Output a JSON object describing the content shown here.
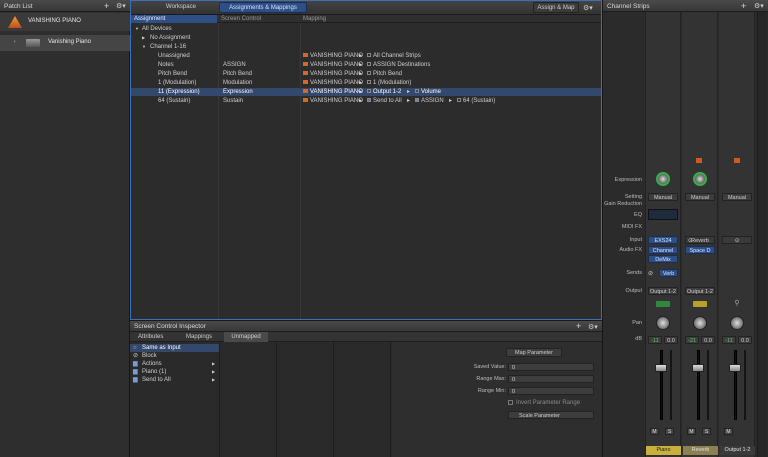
{
  "patch_list": {
    "title": "Patch List",
    "items": [
      {
        "name": "VANISHING PIANO",
        "selected": true
      },
      {
        "name": "Vanishing Piano",
        "selected": false
      }
    ]
  },
  "mapping_window": {
    "tabs": [
      {
        "label": "Workspace",
        "active": false
      },
      {
        "label": "Assignments & Mappings",
        "active": true
      }
    ],
    "assign_map_label": "Assign & Map",
    "columns": {
      "assignment": "Assignment",
      "screen_control": "Screen Control",
      "mapping": "Mapping"
    },
    "tree": [
      {
        "label": "All Devices",
        "indent": 0,
        "arrow": "▼"
      },
      {
        "label": "No Assignment",
        "indent": 1,
        "arrow": "▶"
      },
      {
        "label": "Channel 1-16",
        "indent": 1,
        "arrow": "▼"
      }
    ],
    "rows": [
      {
        "assignment": "Unassigned",
        "control": "",
        "patch": "VANISHING PIANO",
        "target": "All Channel Strips",
        "target2": "",
        "target3": "",
        "selected": false
      },
      {
        "assignment": "Notes",
        "control": "ASSIGN",
        "patch": "VANISHING PIANO",
        "target": "ASSIGN Destinations",
        "target2": "",
        "target3": "",
        "selected": false
      },
      {
        "assignment": "Pitch Bend",
        "control": "Pitch Bend",
        "patch": "VANISHING PIANO",
        "target": "Pitch Bend",
        "target2": "",
        "target3": "",
        "selected": false
      },
      {
        "assignment": "1 (Modulation)",
        "control": "Modulation",
        "patch": "VANISHING PIANO",
        "target": "1 (Modulation)",
        "target2": "",
        "target3": "",
        "selected": false
      },
      {
        "assignment": "11 (Expression)",
        "control": "Expression",
        "patch": "VANISHING PIANO",
        "target": "Output 1-2",
        "target2": "Volume",
        "target3": "",
        "selected": true
      },
      {
        "assignment": "64 (Sustain)",
        "control": "Sustain",
        "patch": "VANISHING PIANO",
        "target": "Send to All",
        "target2": "ASSIGN",
        "target3": "64 (Sustain)",
        "selected": false
      }
    ]
  },
  "inspector": {
    "title": "Screen Control Inspector",
    "tabs": [
      {
        "label": "Attributes",
        "active": false
      },
      {
        "label": "Mappings",
        "active": false
      },
      {
        "label": "Unmapped",
        "active": true
      }
    ],
    "list": [
      {
        "label": "Same as Input",
        "selected": true,
        "arrow": ""
      },
      {
        "label": "Block",
        "selected": false,
        "arrow": ""
      },
      {
        "label": "Actions",
        "selected": false,
        "arrow": "▶"
      },
      {
        "label": "Piano (1)",
        "selected": false,
        "arrow": "▶"
      },
      {
        "label": "Send to All",
        "selected": false,
        "arrow": "▶"
      }
    ],
    "map_param_label": "Map Parameter",
    "saved_value_label": "Saved Value:",
    "saved_value": "0",
    "range_max_label": "Range Max:",
    "range_max": "0",
    "range_min_label": "Range Min:",
    "range_min": "0",
    "invert_label": "Invert Parameter Range",
    "scale_label": "Scale Parameter"
  },
  "channel_strips": {
    "title": "Channel Strips",
    "labels": {
      "expression": "Expression",
      "setting": "Setting",
      "gain_reduction": "Gain Reduction",
      "eq": "EQ",
      "midi_fx": "MIDI FX",
      "input": "Input",
      "audio_fx": "Audio FX",
      "sends": "Sends",
      "output": "Output",
      "pan": "Pan",
      "db": "dB"
    },
    "strips": [
      {
        "name": "Piano",
        "setting": "Manual",
        "input": "EXS24",
        "fx1": "Channel EQ",
        "fx2": "DeMix",
        "send": "Verb",
        "output": "Output 1-2",
        "db1": "-11",
        "db2": "0.0",
        "name_color": "#c9b03a",
        "name_text_color": "#222222"
      },
      {
        "name": "Reverb",
        "setting": "Manual",
        "input": "Reverb",
        "fx1": "Space D",
        "fx2": "",
        "send": "",
        "output": "Output 1-2",
        "db1": "-21",
        "db2": "0.0",
        "name_color": "#8d8050",
        "name_text_color": "#e0e0e0"
      },
      {
        "name": "Output 1-2",
        "setting": "Manual",
        "input": "",
        "fx1": "",
        "fx2": "",
        "send": "",
        "output": "",
        "db1": "-11",
        "db2": "0.0",
        "name_color": "#3a3a3a",
        "name_text_color": "#e0e0e0"
      }
    ],
    "mute_label": "M",
    "solo_label": "S"
  },
  "colors": {
    "accent_blue": "#2d4f86",
    "selection": "#34486c",
    "orange_icon": "#d06a2a",
    "green_knob": "#35b04a"
  }
}
